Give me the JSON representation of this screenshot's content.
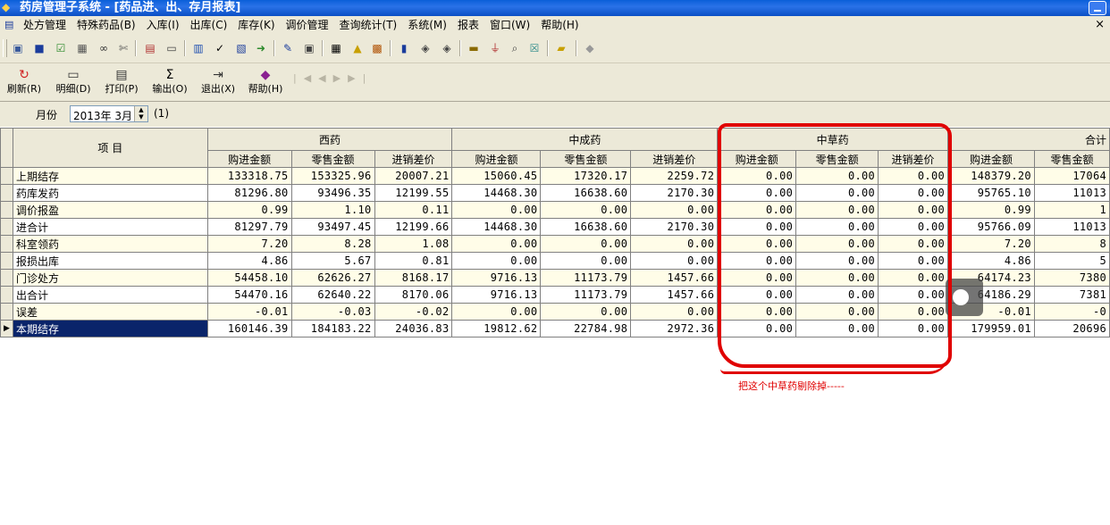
{
  "window": {
    "title": "药房管理子系统 - [药品进、出、存月报表]"
  },
  "menu": [
    "处方管理",
    "特殊药品(B)",
    "入库(I)",
    "出库(C)",
    "库存(K)",
    "调价管理",
    "查询统计(T)",
    "系统(M)",
    "报表",
    "窗口(W)",
    "帮助(H)"
  ],
  "toolbar2": {
    "refresh": "刷新(R)",
    "detail": "明细(D)",
    "print": "打印(P)",
    "output": "输出(O)",
    "exit": "退出(X)",
    "help": "帮助(H)",
    "sigma": "Σ"
  },
  "filter": {
    "label": "月份",
    "value": "2013年  3月",
    "count": "(1)"
  },
  "grid": {
    "item_header": "项  目",
    "groups": [
      "西药",
      "中成药",
      "中草药",
      "合计"
    ],
    "subcols": [
      "购进金额",
      "零售金额",
      "进销差价"
    ],
    "rows": [
      {
        "name": "上期结存",
        "xy": [
          "133318.75",
          "153325.96",
          "20007.21"
        ],
        "zcy": [
          "15060.45",
          "17320.17",
          "2259.72"
        ],
        "zcao": [
          "0.00",
          "0.00",
          "0.00"
        ],
        "total": [
          "148379.20",
          "17064"
        ]
      },
      {
        "name": "药库发药",
        "xy": [
          "81296.80",
          "93496.35",
          "12199.55"
        ],
        "zcy": [
          "14468.30",
          "16638.60",
          "2170.30"
        ],
        "zcao": [
          "0.00",
          "0.00",
          "0.00"
        ],
        "total": [
          "95765.10",
          "11013"
        ]
      },
      {
        "name": "调价报盈",
        "xy": [
          "0.99",
          "1.10",
          "0.11"
        ],
        "zcy": [
          "0.00",
          "0.00",
          "0.00"
        ],
        "zcao": [
          "0.00",
          "0.00",
          "0.00"
        ],
        "total": [
          "0.99",
          "1"
        ]
      },
      {
        "name": "进合计",
        "xy": [
          "81297.79",
          "93497.45",
          "12199.66"
        ],
        "zcy": [
          "14468.30",
          "16638.60",
          "2170.30"
        ],
        "zcao": [
          "0.00",
          "0.00",
          "0.00"
        ],
        "total": [
          "95766.09",
          "11013"
        ]
      },
      {
        "name": "科室领药",
        "xy": [
          "7.20",
          "8.28",
          "1.08"
        ],
        "zcy": [
          "0.00",
          "0.00",
          "0.00"
        ],
        "zcao": [
          "0.00",
          "0.00",
          "0.00"
        ],
        "total": [
          "7.20",
          "8"
        ]
      },
      {
        "name": "报损出库",
        "xy": [
          "4.86",
          "5.67",
          "0.81"
        ],
        "zcy": [
          "0.00",
          "0.00",
          "0.00"
        ],
        "zcao": [
          "0.00",
          "0.00",
          "0.00"
        ],
        "total": [
          "4.86",
          "5"
        ]
      },
      {
        "name": "门诊处方",
        "xy": [
          "54458.10",
          "62626.27",
          "8168.17"
        ],
        "zcy": [
          "9716.13",
          "11173.79",
          "1457.66"
        ],
        "zcao": [
          "0.00",
          "0.00",
          "0.00"
        ],
        "total": [
          "64174.23",
          "7380"
        ]
      },
      {
        "name": "出合计",
        "xy": [
          "54470.16",
          "62640.22",
          "8170.06"
        ],
        "zcy": [
          "9716.13",
          "11173.79",
          "1457.66"
        ],
        "zcao": [
          "0.00",
          "0.00",
          "0.00"
        ],
        "total": [
          "64186.29",
          "7381"
        ]
      },
      {
        "name": "误差",
        "xy": [
          "-0.01",
          "-0.03",
          "-0.02"
        ],
        "zcy": [
          "0.00",
          "0.00",
          "0.00"
        ],
        "zcao": [
          "0.00",
          "0.00",
          "0.00"
        ],
        "total": [
          "-0.01",
          "-0"
        ]
      },
      {
        "name": "本期结存",
        "xy": [
          "160146.39",
          "184183.22",
          "24036.83"
        ],
        "zcy": [
          "19812.62",
          "22784.98",
          "2972.36"
        ],
        "zcao": [
          "0.00",
          "0.00",
          "0.00"
        ],
        "total": [
          "179959.01",
          "20696"
        ]
      }
    ]
  },
  "annotation": "把这个中草药剔除掉-----",
  "colors": {
    "title_blue": "#0a5fd8",
    "selected": "#0a246a",
    "annotation_red": "#e00000",
    "odd_row": "#fffde8"
  }
}
